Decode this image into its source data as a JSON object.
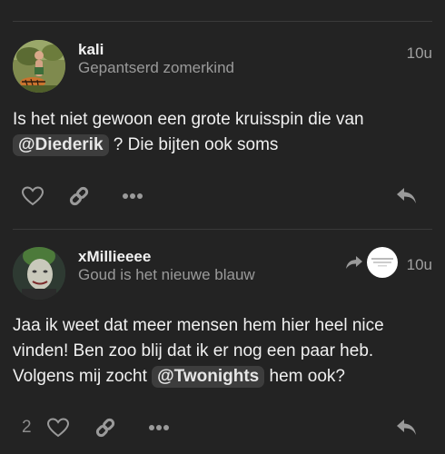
{
  "posts": [
    {
      "username": "kali",
      "user_title": "Gepantserd zomerkind",
      "time": "10u",
      "body_before": "Is het niet gewoon een grote kruisspin die van ",
      "mention": "@Diederik",
      "body_after": " ? Die bijten ook soms",
      "avatar_icon": "avatar-image",
      "like_count": ""
    },
    {
      "username": "xMillieeee",
      "user_title": "Goud is het nieuwe blauw",
      "time": "10u",
      "body_line1": "Jaa ik weet dat meer mensen hem hier heel nice",
      "body_line2": "vinden! Ben zoo blij dat ik er nog een paar heb.",
      "body_line3_before": "Volgens mij zocht ",
      "mention": "@Twonights",
      "body_line3_after": " hem ook?",
      "avatar_icon": "avatar-image",
      "like_count": "2"
    }
  ],
  "icons": {
    "like": "heart-icon",
    "link": "link-icon",
    "more": "ellipsis-icon",
    "reply": "reply-icon",
    "reply_to": "reply-arrow-icon"
  },
  "colors": {
    "background": "#232323",
    "mention_bg": "#3d3d3d",
    "muted_text": "#9a9a9a"
  }
}
